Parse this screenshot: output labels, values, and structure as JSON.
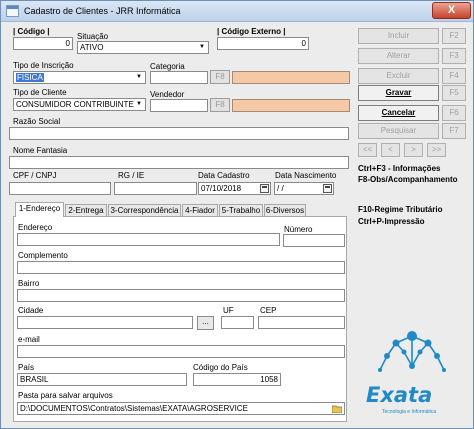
{
  "window": {
    "title": "Cadastro de Clientes - JRR Informática",
    "close_label": "X"
  },
  "form": {
    "codigo_label": "| Código |",
    "codigo_value": "0",
    "situacao_label": "Situação",
    "situacao_value": "ATIVO",
    "codigo_externo_label": "| Código Externo |",
    "codigo_externo_value": "0",
    "tipo_inscricao_label": "Tipo de Inscrição",
    "tipo_inscricao_value": "FISICA",
    "categoria_label": "Categoria",
    "categoria_value": "",
    "categoria_key": "F8",
    "tipo_cliente_label": "Tipo de Cliente",
    "tipo_cliente_value": "CONSUMIDOR CONTRIBUINTE",
    "vendedor_label": "Vendedor",
    "vendedor_value": "",
    "vendedor_key": "F8",
    "razao_social_label": "Razão Social",
    "razao_social_value": "",
    "nome_fantasia_label": "Nome Fantasia",
    "nome_fantasia_value": "",
    "cpf_cnpj_label": "CPF / CNPJ",
    "cpf_cnpj_value": "",
    "rg_ie_label": "RG / IE",
    "rg_ie_value": "",
    "data_cadastro_label": "Data Cadastro",
    "data_cadastro_value": "07/10/2018",
    "data_nascimento_label": "Data Nascimento",
    "data_nascimento_value": " /  / "
  },
  "tabs": [
    {
      "label": "1-Endereço"
    },
    {
      "label": "2-Entrega"
    },
    {
      "label": "3-Correspondência"
    },
    {
      "label": "4-Fiador"
    },
    {
      "label": "5-Trabalho"
    },
    {
      "label": "6-Diversos"
    }
  ],
  "address": {
    "endereco_label": "Endereço",
    "endereco_value": "",
    "numero_label": "Número",
    "numero_value": "",
    "complemento_label": "Complemento",
    "complemento_value": "",
    "bairro_label": "Bairro",
    "bairro_value": "",
    "cidade_label": "Cidade",
    "cidade_value": "",
    "cidade_button": "...",
    "uf_label": "UF",
    "uf_value": "",
    "cep_label": "CEP",
    "cep_value": "",
    "email_label": "e-mail",
    "email_value": "",
    "pais_label": "País",
    "pais_value": "BRASIL",
    "codigo_pais_label": "Código do País",
    "codigo_pais_value": "1058",
    "pasta_label": "Pasta para salvar arquivos",
    "pasta_value": "D:\\DOCUMENTOS\\Contratos\\Sistemas\\EXATA\\AGROSERVICE"
  },
  "sidebar": {
    "buttons": [
      {
        "label": "Incluir",
        "key": "F2"
      },
      {
        "label": "Alterar",
        "key": "F3"
      },
      {
        "label": "Excluir",
        "key": "F4"
      },
      {
        "label": "Gravar",
        "key": "F5"
      },
      {
        "label": "Cancelar",
        "key": "F6"
      },
      {
        "label": "Pesquisar",
        "key": "F7"
      }
    ],
    "nav": {
      "first": "<<",
      "prev": "<",
      "next": ">",
      "last": ">>"
    },
    "info1": "Ctrl+F3 - Informações",
    "info2": "F8-Obs/Acompanhamento",
    "info3": "F10-Regime Tributário",
    "info4": "Ctrl+P-Impressão",
    "logo_text": "Exata",
    "logo_sub": "Tecnologia e Informática"
  },
  "colors": {
    "accent": "#1f8ac6",
    "highlight_field": "#f5c9a6",
    "selection": "#3f78cc"
  }
}
